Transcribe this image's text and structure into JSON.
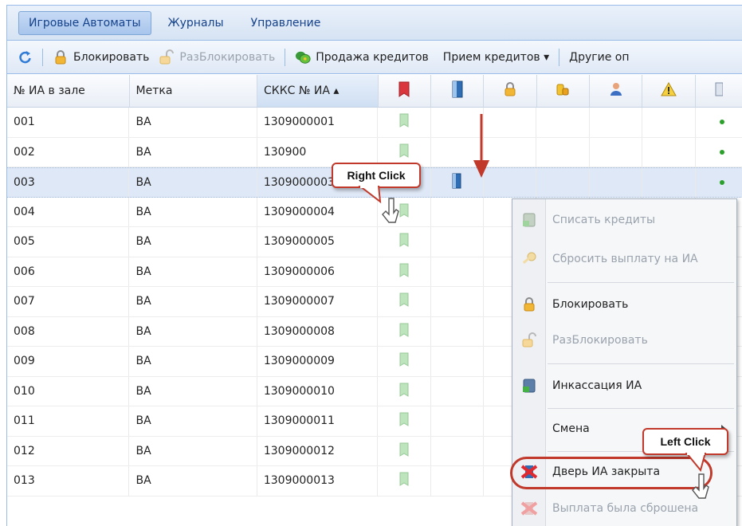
{
  "tabs": [
    {
      "label": "Игровые Автоматы",
      "active": true
    },
    {
      "label": "Журналы",
      "active": false
    },
    {
      "label": "Управление",
      "active": false
    }
  ],
  "toolbar": {
    "refresh_icon": "refresh-icon",
    "lock_label": "Блокировать",
    "unlock_label": "РазБлокировать",
    "sell_label": "Продажа кредитов",
    "receive_label": "Прием кредитов ▾",
    "other_label": "Другие оп"
  },
  "columns": {
    "num": "№ ИА в зале",
    "tag": "Метка",
    "skks": "СККС № ИА ▴"
  },
  "rows": [
    {
      "num": "001",
      "tag": "BA",
      "skks": "1309000001"
    },
    {
      "num": "002",
      "tag": "BA",
      "skks": "130900"
    },
    {
      "num": "003",
      "tag": "BA",
      "skks": "1309000003"
    },
    {
      "num": "004",
      "tag": "BA",
      "skks": "1309000004"
    },
    {
      "num": "005",
      "tag": "BA",
      "skks": "1309000005"
    },
    {
      "num": "006",
      "tag": "BA",
      "skks": "1309000006"
    },
    {
      "num": "007",
      "tag": "BA",
      "skks": "1309000007"
    },
    {
      "num": "008",
      "tag": "BA",
      "skks": "1309000008"
    },
    {
      "num": "009",
      "tag": "BA",
      "skks": "1309000009"
    },
    {
      "num": "010",
      "tag": "BA",
      "skks": "1309000010"
    },
    {
      "num": "011",
      "tag": "BA",
      "skks": "1309000011"
    },
    {
      "num": "012",
      "tag": "BA",
      "skks": "1309000012"
    },
    {
      "num": "013",
      "tag": "BA",
      "skks": "1309000013"
    }
  ],
  "selected_row": "003",
  "context_menu": {
    "write_off": "Списать кредиты",
    "reset_payout": "Сбросить выплату на ИА",
    "lock": "Блокировать",
    "unlock": "РазБлокировать",
    "collection": "Инкассация ИА",
    "shift": "Смена",
    "door_closed": "Дверь ИА закрыта",
    "payout_reset": "Выплата была сброшена"
  },
  "callouts": {
    "right_click": "Right Click",
    "left_click": "Left Click"
  },
  "colors": {
    "accent_red": "#c0392b",
    "header_blue": "#99bbe8",
    "selected_row": "#dfe8f6"
  }
}
